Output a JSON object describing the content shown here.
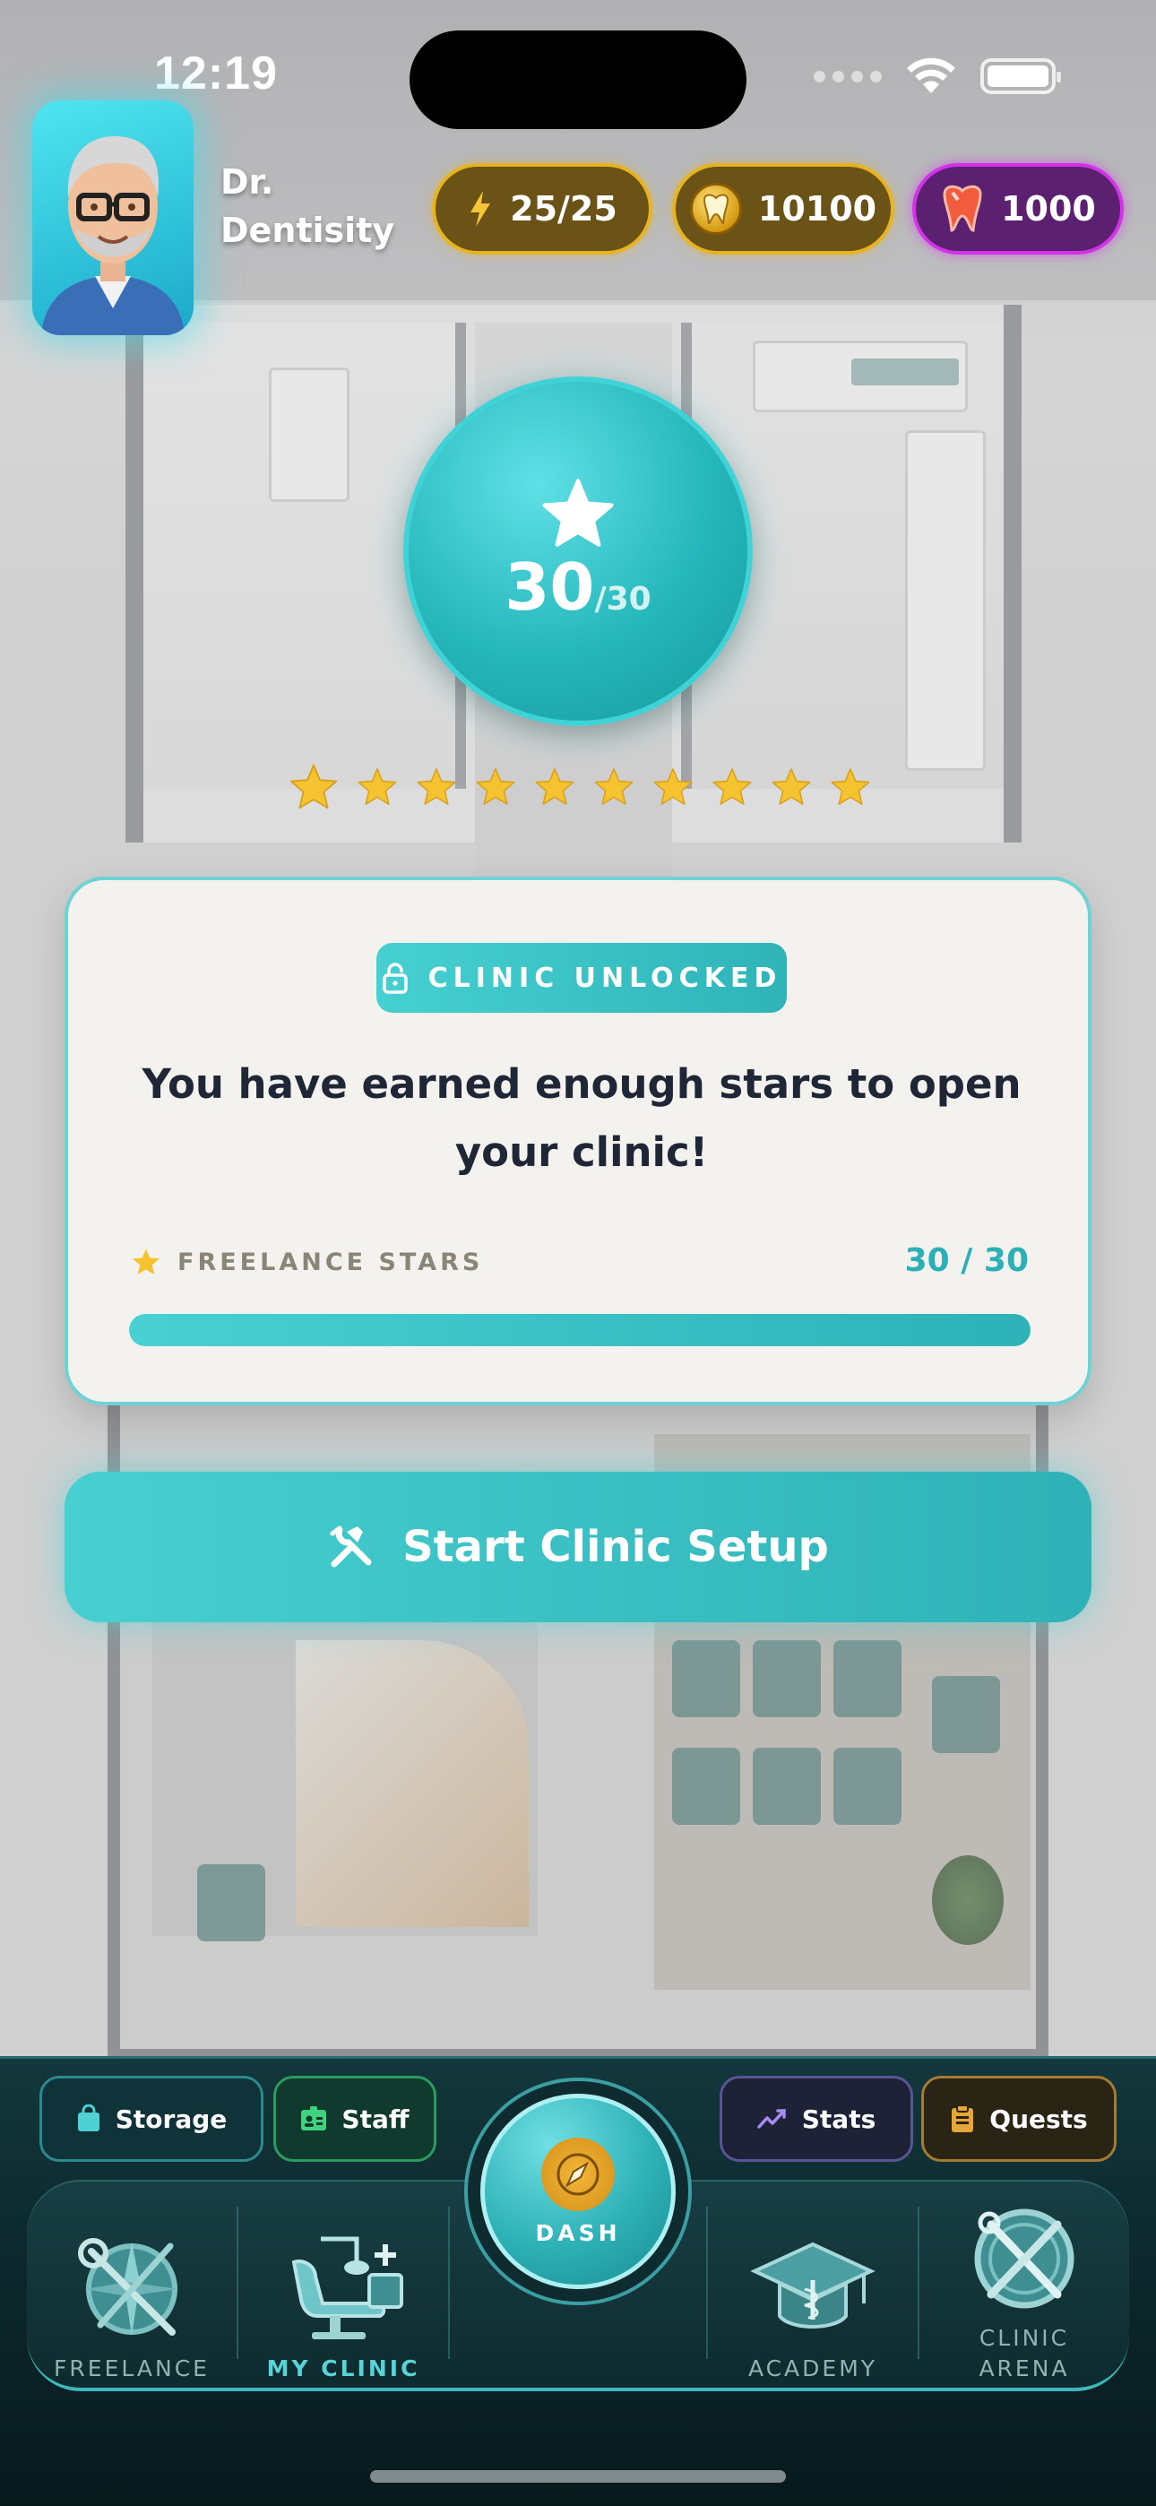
{
  "status_bar": {
    "time": "12:19"
  },
  "player": {
    "name": "Dr. Dentisity"
  },
  "currencies": {
    "energy": "25/25",
    "coins": "10100",
    "gems": "1000"
  },
  "progress": {
    "current": "30",
    "total": "/30",
    "stars_earned": 10,
    "stars_shown": 10
  },
  "card": {
    "badge": "CLINIC UNLOCKED",
    "message": "You have earned enough stars to open your clinic!",
    "stars_label": "FREELANCE STARS",
    "stars_value": "30 / 30",
    "progress_fraction": 1.0
  },
  "cta": {
    "label": "Start Clinic Setup"
  },
  "quick_actions": {
    "storage": "Storage",
    "staff": "Staff",
    "stats": "Stats",
    "quests": "Quests"
  },
  "nav": {
    "freelance": "FREELANCE",
    "my_clinic": "MY CLINIC",
    "dash": "DASH",
    "academy": "ACADEMY",
    "clinic_arena_line1": "CLINIC",
    "clinic_arena_line2": "ARENA",
    "active": "my_clinic"
  },
  "colors": {
    "accent": "#2eb2b7",
    "energy_border": "#e6b321",
    "gems_border": "#d232e8",
    "star": "#f5c330"
  }
}
